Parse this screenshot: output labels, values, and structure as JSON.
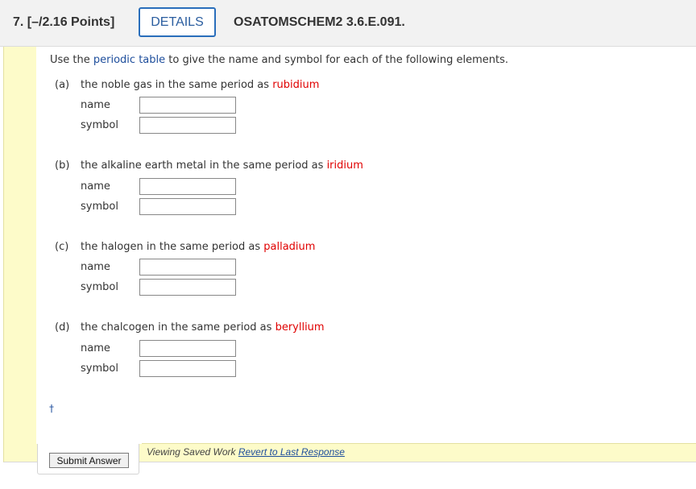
{
  "header": {
    "question_points": "7.  [–/2.16 Points]",
    "details_label": "DETAILS",
    "question_code": "OSATOMSCHEM2 3.6.E.091."
  },
  "prompt": {
    "before": "Use the ",
    "link": "periodic table",
    "after": " to give the name and symbol for each of the following elements."
  },
  "parts": [
    {
      "label": "(a)",
      "text": "the noble gas in the same period as ",
      "element": "rubidium"
    },
    {
      "label": "(b)",
      "text": "the alkaline earth metal in the same period as ",
      "element": "iridium"
    },
    {
      "label": "(c)",
      "text": "the halogen in the same period as ",
      "element": "palladium"
    },
    {
      "label": "(d)",
      "text": "the chalcogen in the same period as ",
      "element": "beryllium"
    }
  ],
  "fields": {
    "name_label": "name",
    "symbol_label": "symbol",
    "name_value": "",
    "symbol_value": ""
  },
  "footer": {
    "dagger": "†",
    "saved_text": "Viewing Saved Work ",
    "revert_link": "Revert to Last Response",
    "submit_label": "Submit Answer"
  },
  "colors": {
    "accent": "#2a6ebb",
    "link": "#1e4e9c",
    "highlight": "#e00000",
    "panel": "#fdfbc9"
  }
}
